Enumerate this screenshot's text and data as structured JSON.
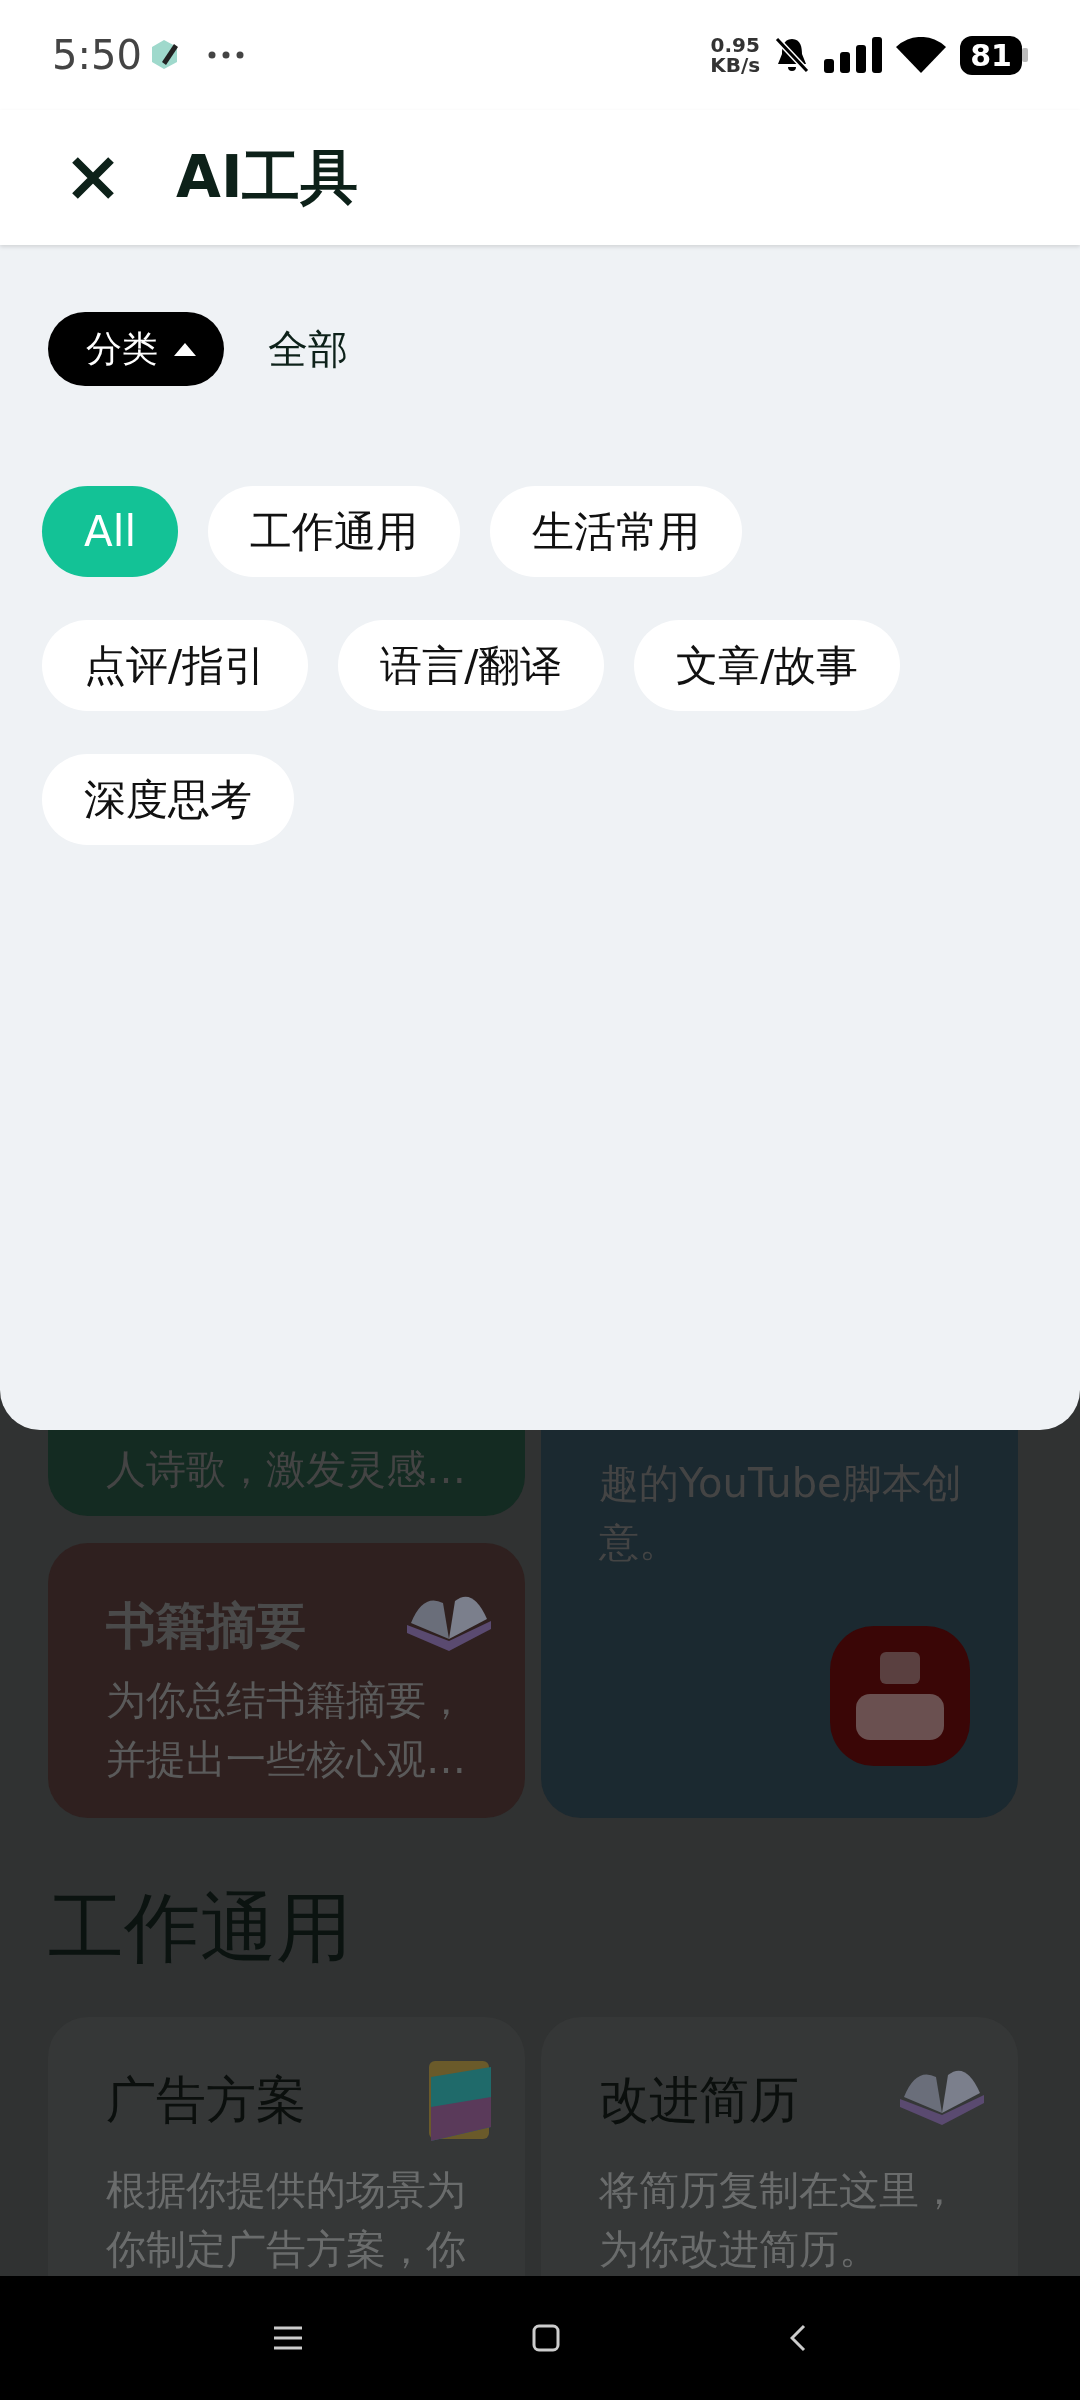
{
  "status_bar": {
    "time": "5:50",
    "net_speed": "0.95",
    "net_unit": "KB/s",
    "battery": "81"
  },
  "header": {
    "title": "AI工具"
  },
  "filter": {
    "dropdown": {
      "label": "分类",
      "expanded": true
    },
    "value": "全部"
  },
  "categories": [
    {
      "label": "All",
      "selected": true
    },
    {
      "label": "工作通用",
      "selected": false
    },
    {
      "label": "生活常用",
      "selected": false
    },
    {
      "label": "点评/指引",
      "selected": false
    },
    {
      "label": "语言/翻译",
      "selected": false
    },
    {
      "label": "文章/故事",
      "selected": false
    },
    {
      "label": "深度思考",
      "selected": false
    }
  ],
  "featured": {
    "left": [
      {
        "color": "#142b22",
        "lines": [
          "人诗歌，激发灵感…"
        ]
      },
      {
        "color": "#2f201f",
        "title": "书籍摘要",
        "kind": "book",
        "lines": [
          "为你总结书籍摘要，",
          "并提出一些核心观…"
        ]
      }
    ],
    "right": {
      "color": "#1b2930",
      "lines": [
        "趣的YouTube脚本创",
        "意。"
      ],
      "kind": "youtube"
    }
  },
  "section": {
    "title": "工作通用",
    "cards": [
      {
        "title": "广告方案",
        "kind": "folder",
        "lines": [
          "根据你提供的场景为",
          "你制定广告方案，你"
        ]
      },
      {
        "title": "改进简历",
        "kind": "book",
        "lines": [
          "将简历复制在这里，",
          "为你改进简历。"
        ]
      }
    ]
  }
}
